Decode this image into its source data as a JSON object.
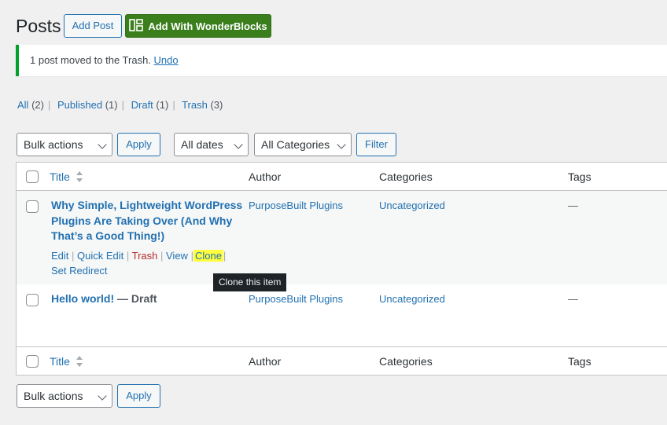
{
  "header": {
    "title": "Posts",
    "add_post_label": "Add Post",
    "add_wonderblocks_label": "Add With WonderBlocks"
  },
  "notice": {
    "message": "1 post moved to the Trash.",
    "undo_label": "Undo"
  },
  "views": [
    {
      "label": "All",
      "count": "(2)"
    },
    {
      "label": "Published",
      "count": "(1)"
    },
    {
      "label": "Draft",
      "count": "(1)"
    },
    {
      "label": "Trash",
      "count": "(3)"
    }
  ],
  "filters": {
    "bulk_actions": "Bulk actions",
    "apply_label": "Apply",
    "dates": "All dates",
    "categories": "All Categories",
    "filter_label": "Filter"
  },
  "table": {
    "columns": {
      "title": "Title",
      "author": "Author",
      "categories": "Categories",
      "tags": "Tags"
    },
    "rows": [
      {
        "title_line1": "Why Simple, Lightweight WordPress",
        "title_line2": "Plugins Are Taking Over (And Why",
        "title_line3": "That’s a Good Thing!)",
        "state": "",
        "author": "PurposeBuilt Plugins",
        "category": "Uncategorized",
        "tags": "—",
        "actions": {
          "edit": "Edit",
          "quick_edit": "Quick Edit",
          "trash": "Trash",
          "view": "View",
          "clone": "Clone",
          "set_redirect": "Set Redirect"
        }
      },
      {
        "title": "Hello world!",
        "state": " — Draft",
        "author": "PurposeBuilt Plugins",
        "category": "Uncategorized",
        "tags": "—"
      }
    ]
  },
  "tooltip": "Clone this item",
  "colors": {
    "accent": "#2271b1",
    "success": "#00a32a",
    "wonderblocks_green": "#3a7f1c",
    "highlight": "#ffff3c",
    "trash": "#b32d2e"
  }
}
